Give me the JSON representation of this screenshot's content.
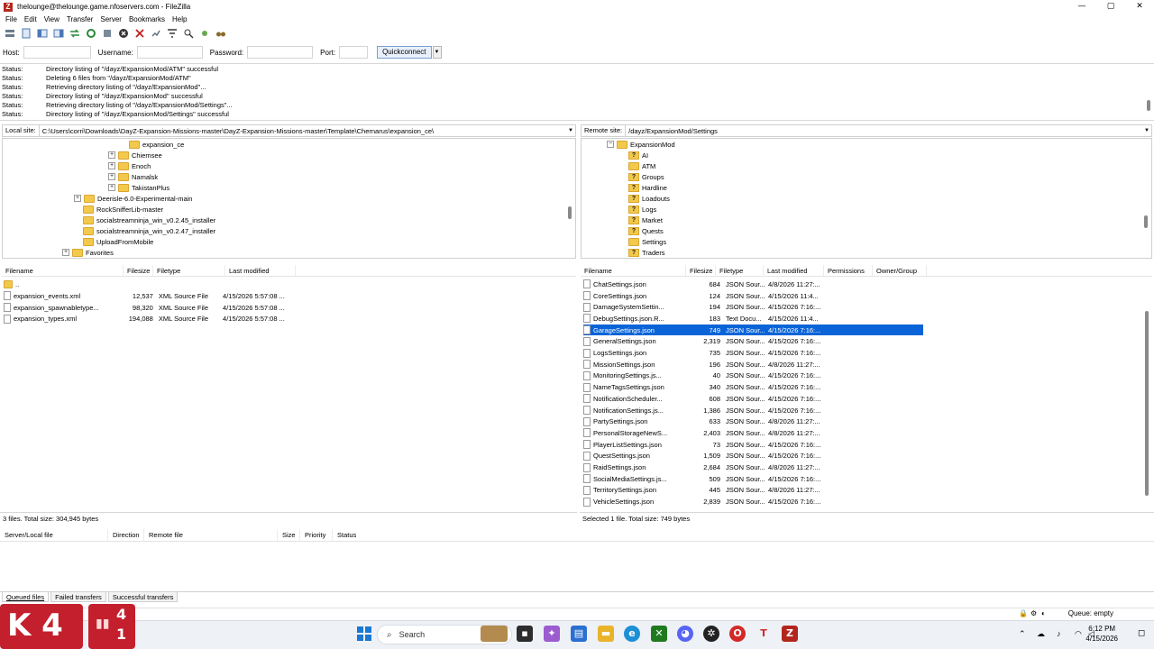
{
  "window": {
    "title": "thelounge@thelounge.game.nfoservers.com - FileZilla",
    "app_icon": "Z",
    "minimize": "—",
    "maximize": "▢",
    "close": "✕"
  },
  "menu": [
    "File",
    "Edit",
    "View",
    "Transfer",
    "Server",
    "Bookmarks",
    "Help"
  ],
  "toolbar_icons": [
    "site-manager-icon",
    "toggle-log-icon",
    "toggle-local-tree-icon",
    "toggle-remote-tree-icon",
    "toggle-queue-icon",
    "refresh-icon",
    "process-queue-icon",
    "cancel-icon",
    "disconnect-icon",
    "reconnect-icon",
    "filter-icon",
    "compare-icon",
    "sync-browse-icon",
    "find-icon"
  ],
  "quickconnect": {
    "host_label": "Host:",
    "username_label": "Username:",
    "password_label": "Password:",
    "port_label": "Port:",
    "button": "Quickconnect",
    "dropdown": "▼"
  },
  "log": [
    {
      "label": "Status:",
      "text": "Directory listing of \"/dayz/ExpansionMod/ATM\" successful"
    },
    {
      "label": "Status:",
      "text": "Deleting 6 files from \"/dayz/ExpansionMod/ATM\""
    },
    {
      "label": "Status:",
      "text": "Retrieving directory listing of \"/dayz/ExpansionMod\"..."
    },
    {
      "label": "Status:",
      "text": "Directory listing of \"/dayz/ExpansionMod\" successful"
    },
    {
      "label": "Status:",
      "text": "Retrieving directory listing of \"/dayz/ExpansionMod/Settings\"..."
    },
    {
      "label": "Status:",
      "text": "Directory listing of \"/dayz/ExpansionMod/Settings\" successful"
    }
  ],
  "local": {
    "site_label": "Local site:",
    "path": "C:\\Users\\corri\\Downloads\\DayZ-Expansion-Missions-master\\DayZ-Expansion-Missions-master\\Template\\Chernarus\\expansion_ce\\",
    "tree": [
      {
        "name": "expansion_ce",
        "expander": ""
      },
      {
        "name": "Chiemsee",
        "expander": "+"
      },
      {
        "name": "Enoch",
        "expander": "+"
      },
      {
        "name": "Namalsk",
        "expander": "+"
      },
      {
        "name": "TakistanPlus",
        "expander": "+"
      },
      {
        "name": "Deerisle-6.0-Experimental-main",
        "expander": "+"
      },
      {
        "name": "RockSnifferLib-master",
        "expander": ""
      },
      {
        "name": "socialstreamninja_win_v0.2.45_installer",
        "expander": ""
      },
      {
        "name": "socialstreamninja_win_v0.2.47_installer",
        "expander": ""
      },
      {
        "name": "UploadFromMobile",
        "expander": ""
      },
      {
        "name": "Favorites",
        "expander": "+"
      }
    ],
    "columns": [
      "Filename",
      "Filesize",
      "Filetype",
      "Last modified"
    ],
    "files": [
      {
        "name": "..",
        "size": "",
        "type": "",
        "modified": ""
      },
      {
        "name": "expansion_events.xml",
        "size": "12,537",
        "type": "XML Source File",
        "modified": "4/15/2026 5:57:08 ..."
      },
      {
        "name": "expansion_spawnabletype...",
        "size": "98,320",
        "type": "XML Source File",
        "modified": "4/15/2026 5:57:08 ..."
      },
      {
        "name": "expansion_types.xml",
        "size": "194,088",
        "type": "XML Source File",
        "modified": "4/15/2026 5:57:08 ..."
      }
    ],
    "status": "3 files. Total size: 304,945 bytes"
  },
  "remote": {
    "site_label": "Remote site:",
    "path": "/dayz/ExpansionMod/Settings",
    "tree": [
      {
        "name": "ExpansionMod",
        "kind": "folder",
        "expander": "−"
      },
      {
        "name": "AI",
        "kind": "unknown"
      },
      {
        "name": "ATM",
        "kind": "folder"
      },
      {
        "name": "Groups",
        "kind": "unknown"
      },
      {
        "name": "Hardline",
        "kind": "unknown"
      },
      {
        "name": "Loadouts",
        "kind": "unknown"
      },
      {
        "name": "Logs",
        "kind": "unknown"
      },
      {
        "name": "Market",
        "kind": "unknown"
      },
      {
        "name": "Quests",
        "kind": "unknown"
      },
      {
        "name": "Settings",
        "kind": "folder"
      },
      {
        "name": "Traders",
        "kind": "unknown"
      }
    ],
    "columns": [
      "Filename",
      "Filesize",
      "Filetype",
      "Last modified",
      "Permissions",
      "Owner/Group"
    ],
    "files": [
      {
        "name": "ChatSettings.json",
        "size": "684",
        "type": "JSON Sour...",
        "modified": "4/8/2026 11:27:..."
      },
      {
        "name": "CoreSettings.json",
        "size": "124",
        "type": "JSON Sour...",
        "modified": "4/15/2026 11:4..."
      },
      {
        "name": "DamageSystemSettin...",
        "size": "194",
        "type": "JSON Sour...",
        "modified": "4/15/2026 7:16:..."
      },
      {
        "name": "DebugSettings.json.R...",
        "size": "183",
        "type": "Text Docu...",
        "modified": "4/15/2026 11:4..."
      },
      {
        "name": "GarageSettings.json",
        "size": "749",
        "type": "JSON Sour...",
        "modified": "4/15/2026 7:16:..."
      },
      {
        "name": "GeneralSettings.json",
        "size": "2,319",
        "type": "JSON Sour...",
        "modified": "4/15/2026 7:16:..."
      },
      {
        "name": "LogsSettings.json",
        "size": "735",
        "type": "JSON Sour...",
        "modified": "4/15/2026 7:16:..."
      },
      {
        "name": "MissionSettings.json",
        "size": "196",
        "type": "JSON Sour...",
        "modified": "4/8/2026 11:27:..."
      },
      {
        "name": "MonitoringSettings.js...",
        "size": "40",
        "type": "JSON Sour...",
        "modified": "4/15/2026 7:16:..."
      },
      {
        "name": "NameTagsSettings.json",
        "size": "340",
        "type": "JSON Sour...",
        "modified": "4/15/2026 7:16:..."
      },
      {
        "name": "NotificationScheduler...",
        "size": "608",
        "type": "JSON Sour...",
        "modified": "4/15/2026 7:16:..."
      },
      {
        "name": "NotificationSettings.js...",
        "size": "1,386",
        "type": "JSON Sour...",
        "modified": "4/15/2026 7:16:..."
      },
      {
        "name": "PartySettings.json",
        "size": "633",
        "type": "JSON Sour...",
        "modified": "4/8/2026 11:27:..."
      },
      {
        "name": "PersonalStorageNewS...",
        "size": "2,403",
        "type": "JSON Sour...",
        "modified": "4/8/2026 11:27:..."
      },
      {
        "name": "PlayerListSettings.json",
        "size": "73",
        "type": "JSON Sour...",
        "modified": "4/15/2026 7:16:..."
      },
      {
        "name": "QuestSettings.json",
        "size": "1,509",
        "type": "JSON Sour...",
        "modified": "4/15/2026 7:16:..."
      },
      {
        "name": "RaidSettings.json",
        "size": "2,684",
        "type": "JSON Sour...",
        "modified": "4/8/2026 11:27:..."
      },
      {
        "name": "SocialMediaSettings.js...",
        "size": "509",
        "type": "JSON Sour...",
        "modified": "4/15/2026 7:16:..."
      },
      {
        "name": "TerritorySettings.json",
        "size": "445",
        "type": "JSON Sour...",
        "modified": "4/8/2026 11:27:..."
      },
      {
        "name": "VehicleSettings.json",
        "size": "2,839",
        "type": "JSON Sour...",
        "modified": "4/15/2026 7:16:..."
      }
    ],
    "selected_index": 4,
    "status": "Selected 1 file. Total size: 749 bytes"
  },
  "queue": {
    "columns": [
      "Server/Local file",
      "Direction",
      "Remote file",
      "Size",
      "Priority",
      "Status"
    ],
    "tabs": [
      "Queued files",
      "Failed transfers",
      "Successful transfers"
    ],
    "status": "Queue: empty"
  },
  "overlay_badges": {
    "left": "K 4",
    "right_top": "4",
    "right_bottom": "1"
  },
  "taskbar": {
    "search_label": "Search",
    "time": "6:12 PM",
    "date": "4/15/2026"
  },
  "colors": {
    "selection": "#0a64d8",
    "folder": "#f3c94c",
    "badge": "#c41f2c",
    "filezilla": "#b3261e"
  }
}
